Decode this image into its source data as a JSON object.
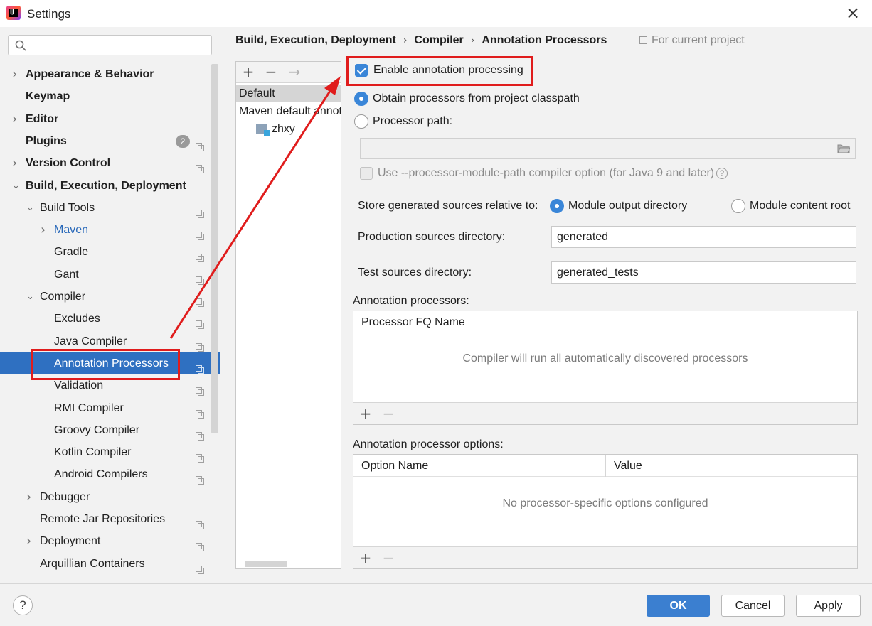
{
  "window": {
    "title": "Settings",
    "icon_name": "intellij-idea-icon"
  },
  "sidebar": {
    "search_placeholder": "",
    "items": [
      {
        "label": "Appearance & Behavior",
        "bold": true,
        "arrow": "right"
      },
      {
        "label": "Keymap",
        "bold": true
      },
      {
        "label": "Editor",
        "bold": true,
        "arrow": "right"
      },
      {
        "label": "Plugins",
        "bold": true,
        "badge": "2"
      },
      {
        "label": "Version Control",
        "bold": true,
        "arrow": "right"
      },
      {
        "label": "Build, Execution, Deployment",
        "bold": true,
        "arrow": "down"
      },
      {
        "label": "Build Tools",
        "arrow": "down"
      },
      {
        "label": "Maven",
        "arrow": "right",
        "color": "#2868b9"
      },
      {
        "label": "Gradle"
      },
      {
        "label": "Gant"
      },
      {
        "label": "Compiler",
        "arrow": "down"
      },
      {
        "label": "Excludes"
      },
      {
        "label": "Java Compiler"
      },
      {
        "label": "Annotation Processors",
        "selected": true
      },
      {
        "label": "Validation"
      },
      {
        "label": "RMI Compiler"
      },
      {
        "label": "Groovy Compiler"
      },
      {
        "label": "Kotlin Compiler"
      },
      {
        "label": "Android Compilers"
      },
      {
        "label": "Debugger",
        "arrow": "right"
      },
      {
        "label": "Remote Jar Repositories"
      },
      {
        "label": "Deployment",
        "arrow": "right"
      },
      {
        "label": "Arquillian Containers"
      }
    ]
  },
  "breadcrumb": [
    "Build, Execution, Deployment",
    "Compiler",
    "Annotation Processors"
  ],
  "for_current_project": "For current project",
  "profiles": {
    "toolbar": [
      "+",
      "−",
      "→"
    ],
    "items": [
      "Default",
      "Maven default annotation processors profile",
      "zhxy"
    ]
  },
  "options": {
    "enable": "Enable annotation processing",
    "obtain_classpath": "Obtain processors from project classpath",
    "processor_path": "Processor path:",
    "processor_path_value": "",
    "module_path": "Use --processor-module-path compiler option (for Java 9 and later)",
    "store_label": "Store generated sources relative to:",
    "module_output": "Module output directory",
    "module_content": "Module content root",
    "prod_label": "Production sources directory:",
    "prod_value": "generated",
    "test_label": "Test sources directory:",
    "test_value": "generated_tests"
  },
  "processors": {
    "title": "Annotation processors:",
    "header": "Processor FQ Name",
    "empty": "Compiler will run all automatically discovered processors"
  },
  "processor_options": {
    "title": "Annotation processor options:",
    "col_name": "Option Name",
    "col_value": "Value",
    "empty": "No processor-specific options configured"
  },
  "footer": {
    "help": "?",
    "ok": "OK",
    "cancel": "Cancel",
    "apply": "Apply"
  },
  "colors": {
    "selection": "#2f70c1",
    "accent": "#3a86d8",
    "annotation": "#e01c1c"
  }
}
